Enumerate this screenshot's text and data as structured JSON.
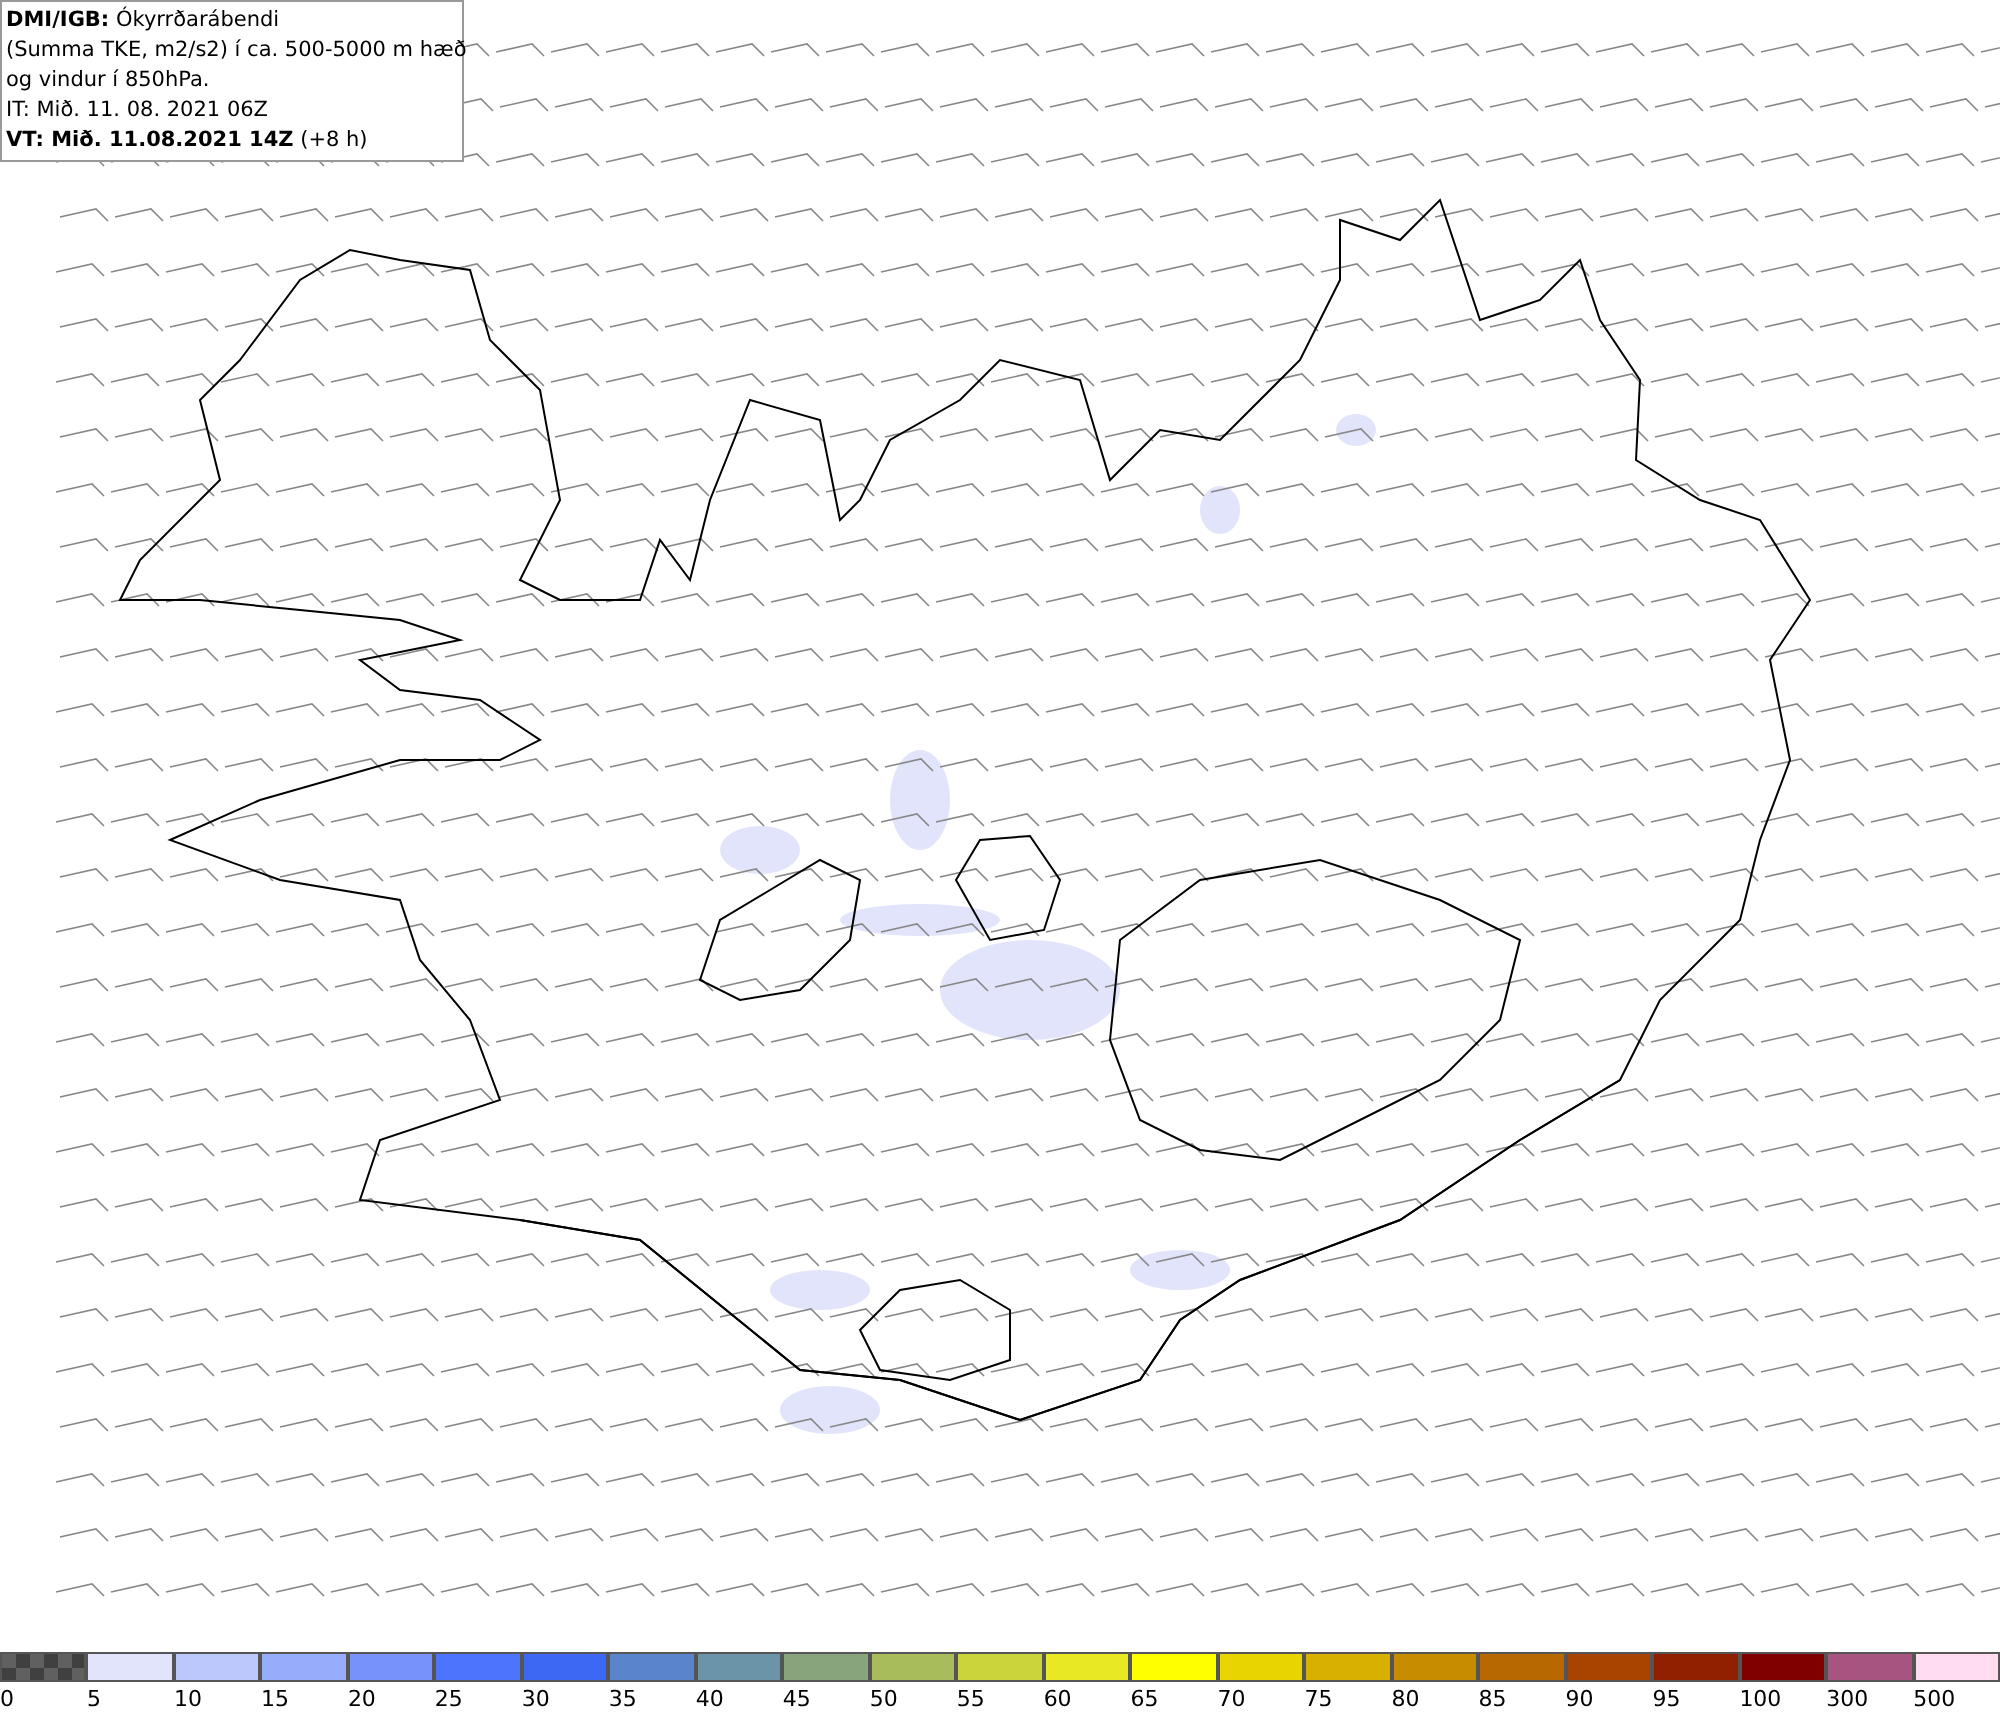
{
  "title_box": {
    "lines": [
      "**DMI/IGB:** Ókyrrðarábendi",
      "(Summa TKE, m2/s2) í ca. 500-5000 m hæð",
      "og vindur í 850hPa.",
      "IT: Mið. 11. 08. 2021 06Z",
      "**VT: Mið. 11.08.2021 14Z** (+8 h)"
    ]
  },
  "legend": [
    {
      "label": "0",
      "color": "#606060",
      "kind": "checker"
    },
    {
      "label": "5",
      "color": "#e2e4fc",
      "kind": "solid"
    },
    {
      "label": "10",
      "color": "#bcc8fc",
      "kind": "solid"
    },
    {
      "label": "15",
      "color": "#98acfc",
      "kind": "solid"
    },
    {
      "label": "20",
      "color": "#7892fc",
      "kind": "solid"
    },
    {
      "label": "25",
      "color": "#4c74fc",
      "kind": "solid"
    },
    {
      "label": "30",
      "color": "#3c68f4",
      "kind": "solid"
    },
    {
      "label": "35",
      "color": "#5a84cc",
      "kind": "solid"
    },
    {
      "label": "40",
      "color": "#6c94a8",
      "kind": "solid"
    },
    {
      "label": "45",
      "color": "#88a47c",
      "kind": "solid"
    },
    {
      "label": "50",
      "color": "#a8bc5c",
      "kind": "solid"
    },
    {
      "label": "55",
      "color": "#ccd43c",
      "kind": "solid"
    },
    {
      "label": "60",
      "color": "#e8e824",
      "kind": "solid"
    },
    {
      "label": "65",
      "color": "#ffff00",
      "kind": "solid"
    },
    {
      "label": "70",
      "color": "#e8d400",
      "kind": "solid"
    },
    {
      "label": "75",
      "color": "#d8b000",
      "kind": "solid"
    },
    {
      "label": "80",
      "color": "#c88c00",
      "kind": "solid"
    },
    {
      "label": "85",
      "color": "#b86800",
      "kind": "solid"
    },
    {
      "label": "90",
      "color": "#a84400",
      "kind": "solid"
    },
    {
      "label": "95",
      "color": "#902000",
      "kind": "solid"
    },
    {
      "label": "100",
      "color": "#800000",
      "kind": "solid"
    },
    {
      "label": "300",
      "color": "#a85480",
      "kind": "solid"
    },
    {
      "label": "500",
      "color": "#ffdcf0",
      "kind": "solid"
    }
  ]
}
